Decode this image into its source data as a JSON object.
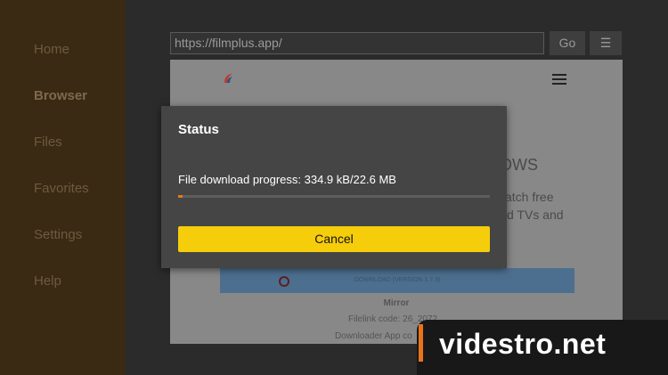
{
  "sidebar": {
    "items": [
      {
        "label": "Home"
      },
      {
        "label": "Browser"
      },
      {
        "label": "Files"
      },
      {
        "label": "Favorites"
      },
      {
        "label": "Settings"
      },
      {
        "label": "Help"
      }
    ],
    "active": "Browser"
  },
  "browser": {
    "url": "https://filmplus.app/",
    "go_label": "Go",
    "menu_label": "☰"
  },
  "webpage": {
    "heading_fragment": "OWS",
    "line1_fragment": "atch free",
    "line2_fragment": "d TVs and",
    "download_label": "DOWNLOAD (VERSION 1.7.9)",
    "mirror_label": "Mirror",
    "filelink_label": "Filelink code: 26_2072",
    "downloader_label": "Downloader App co"
  },
  "dialog": {
    "title": "Status",
    "message": "File download progress: 334.9 kB/22.6 MB",
    "progress_fraction": 0.0148,
    "cancel_label": "Cancel"
  },
  "watermark": {
    "text": "videstro.net"
  },
  "colors": {
    "sidebar_bg": "#3a2a14",
    "accent_yellow": "#f6cd0a",
    "progress_orange": "#e07a1f"
  }
}
